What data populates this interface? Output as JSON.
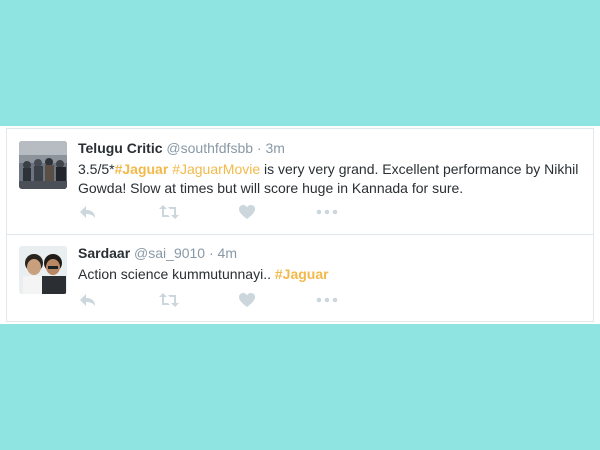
{
  "tweets": [
    {
      "display_name": "Telugu Critic",
      "handle": "@southfdfsbb",
      "separator": "·",
      "time": "3m",
      "text_prefix": "3.5/5*",
      "hashtag_1": "#Jaguar",
      "hashtag_2": "#JaguarMovie",
      "text_suffix": " is very very grand. Excellent performance by Nikhil Gowda! Slow at times but will score huge in Kannada for sure."
    },
    {
      "display_name": "Sardaar",
      "handle": "@sai_9010",
      "separator": "·",
      "time": "4m",
      "text_prefix": "Action science kummutunnayi.. ",
      "hashtag_1": "#Jaguar"
    }
  ],
  "colors": {
    "background": "#8fe3e0",
    "hashtag": "#f2b94a",
    "icon": "#ccd6dd",
    "name": "#292f33",
    "meta": "#8899a6"
  },
  "icons": [
    "reply-icon",
    "retweet-icon",
    "like-icon",
    "more-icon"
  ]
}
